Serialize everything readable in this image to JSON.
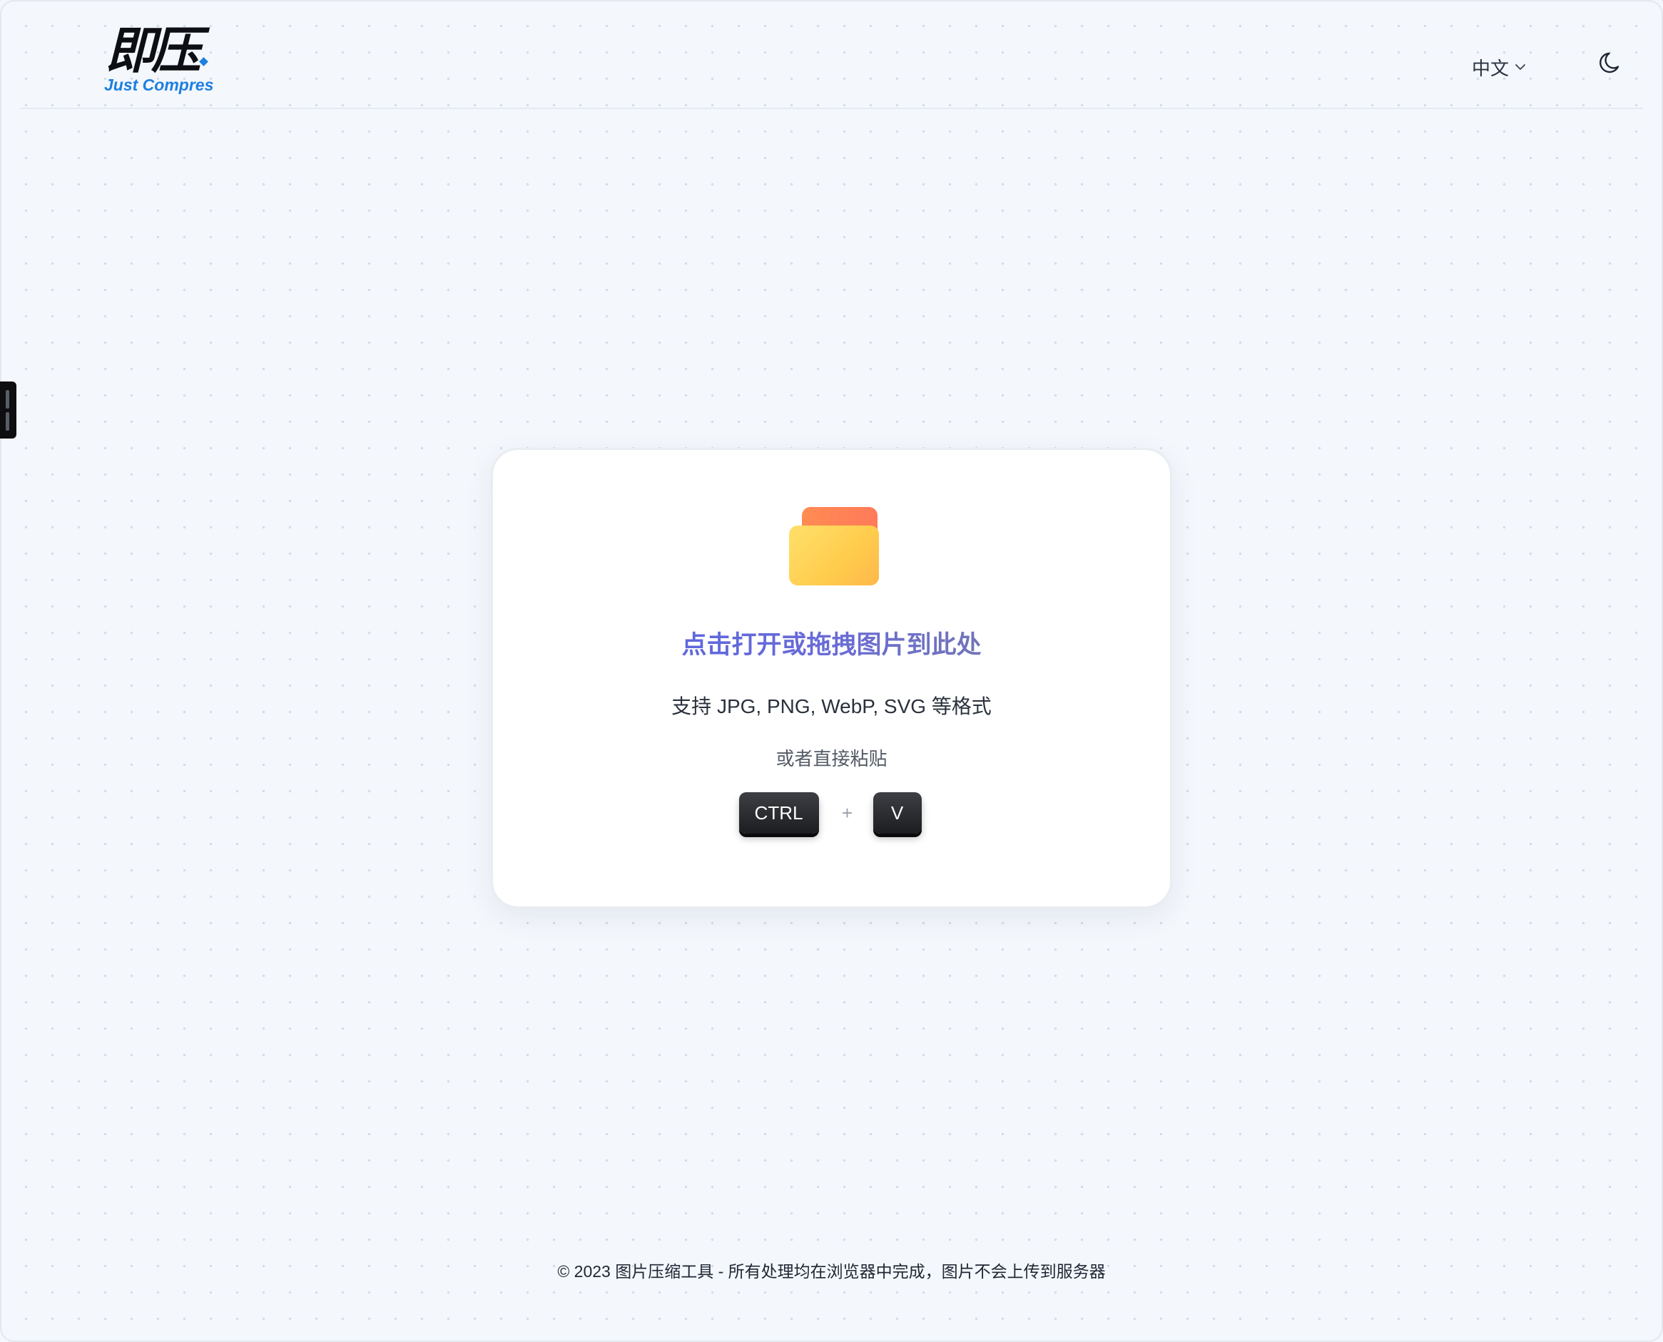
{
  "header": {
    "logo": {
      "cn": "即压",
      "en": "Just Compres"
    },
    "language": {
      "selected": "中文",
      "icon": "chevron-down-icon"
    },
    "theme_toggle_icon": "moon-icon"
  },
  "upload_card": {
    "icon": "folder-icon",
    "title": "点击打开或拖拽图片到此处",
    "formats": "支持 JPG, PNG, WebP, SVG 等格式",
    "paste_hint": "或者直接粘贴",
    "keys": {
      "ctrl": "CTRL",
      "plus": "+",
      "v": "V"
    }
  },
  "footer": {
    "text": "© 2023 图片压缩工具 - 所有处理均在浏览器中完成，图片不会上传到服务器"
  },
  "colors": {
    "background": "#f4f7fc",
    "accent": "#4f63e6",
    "logo_blue": "#1d7fe0",
    "folder_top": "#ff8b52",
    "folder_body": "#ffcc4d"
  }
}
